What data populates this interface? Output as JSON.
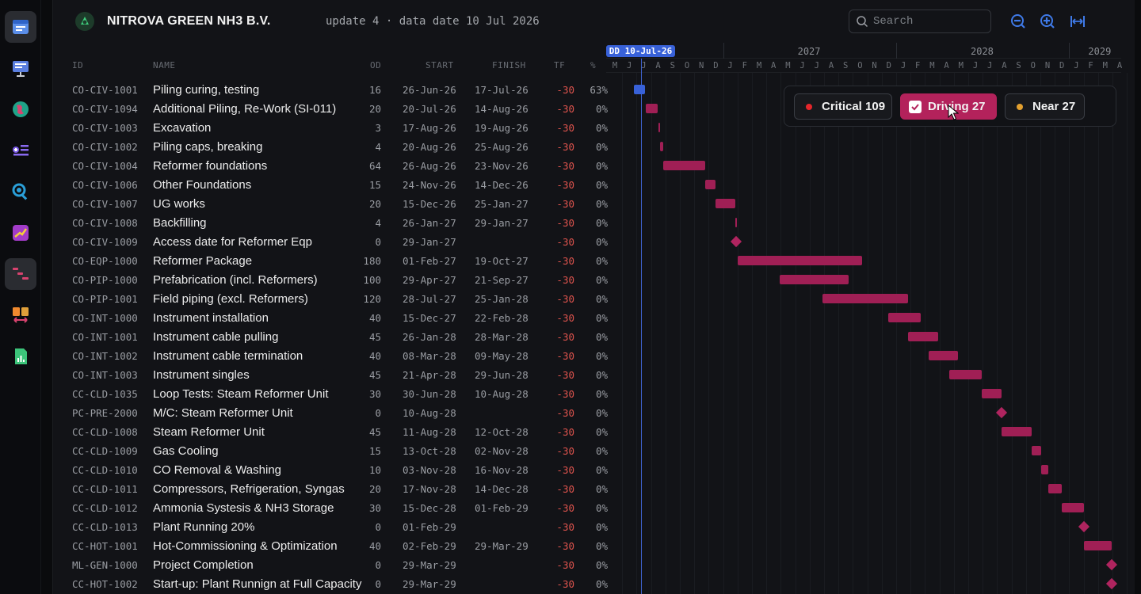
{
  "header": {
    "company": "NITROVA GREEN NH3 B.V.",
    "update": "update 4 · data date 10 Jul 2026",
    "search_placeholder": "Search"
  },
  "columns": {
    "id": "ID",
    "name": "NAME",
    "od": "OD",
    "start": "START",
    "finish": "FINISH",
    "tf": "TF",
    "pct": "%"
  },
  "timeline": {
    "data_date_label": "DD 10-Jul-26",
    "years": [
      "2027",
      "2028",
      "2029"
    ],
    "months": [
      "M",
      "J",
      "J",
      "A",
      "S",
      "O",
      "N",
      "D",
      "J",
      "F",
      "M",
      "A",
      "M",
      "J",
      "J",
      "A",
      "S",
      "O",
      "N",
      "D",
      "J",
      "F",
      "M",
      "A",
      "M",
      "J",
      "J",
      "A",
      "S",
      "O",
      "N",
      "D",
      "J",
      "F",
      "M",
      "A"
    ]
  },
  "filters": {
    "critical_label": "Critical 109",
    "driving_label": "Driving 27",
    "near_label": "Near 27",
    "critical_color": "#e5262b",
    "near_color": "#e3a02f",
    "driving_color": "#b3225b"
  },
  "activities": [
    {
      "id": "CO-CIV-1001",
      "name": "Piling curing, testing",
      "od": "16",
      "start": "26-Jun-26",
      "finish": "17-Jul-26",
      "tf": "-30",
      "pct": "63%"
    },
    {
      "id": "CO-CIV-1094",
      "name": "Additional Piling, Re-Work (SI-011)",
      "od": "20",
      "start": "20-Jul-26",
      "finish": "14-Aug-26",
      "tf": "-30",
      "pct": "0%"
    },
    {
      "id": "CO-CIV-1003",
      "name": "Excavation",
      "od": "3",
      "start": "17-Aug-26",
      "finish": "19-Aug-26",
      "tf": "-30",
      "pct": "0%"
    },
    {
      "id": "CO-CIV-1002",
      "name": "Piling caps, breaking",
      "od": "4",
      "start": "20-Aug-26",
      "finish": "25-Aug-26",
      "tf": "-30",
      "pct": "0%"
    },
    {
      "id": "CO-CIV-1004",
      "name": "Reformer foundations",
      "od": "64",
      "start": "26-Aug-26",
      "finish": "23-Nov-26",
      "tf": "-30",
      "pct": "0%"
    },
    {
      "id": "CO-CIV-1006",
      "name": "Other Foundations",
      "od": "15",
      "start": "24-Nov-26",
      "finish": "14-Dec-26",
      "tf": "-30",
      "pct": "0%"
    },
    {
      "id": "CO-CIV-1007",
      "name": "UG works",
      "od": "20",
      "start": "15-Dec-26",
      "finish": "25-Jan-27",
      "tf": "-30",
      "pct": "0%"
    },
    {
      "id": "CO-CIV-1008",
      "name": "Backfilling",
      "od": "4",
      "start": "26-Jan-27",
      "finish": "29-Jan-27",
      "tf": "-30",
      "pct": "0%"
    },
    {
      "id": "CO-CIV-1009",
      "name": "Access date for Reformer Eqp",
      "od": "0",
      "start": "29-Jan-27",
      "finish": "",
      "tf": "-30",
      "pct": "0%"
    },
    {
      "id": "CO-EQP-1000",
      "name": "Reformer Package",
      "od": "180",
      "start": "01-Feb-27",
      "finish": "19-Oct-27",
      "tf": "-30",
      "pct": "0%"
    },
    {
      "id": "CO-PIP-1000",
      "name": "Prefabrication (incl. Reformers)",
      "od": "100",
      "start": "29-Apr-27",
      "finish": "21-Sep-27",
      "tf": "-30",
      "pct": "0%"
    },
    {
      "id": "CO-PIP-1001",
      "name": "Field piping (excl. Reformers)",
      "od": "120",
      "start": "28-Jul-27",
      "finish": "25-Jan-28",
      "tf": "-30",
      "pct": "0%"
    },
    {
      "id": "CO-INT-1000",
      "name": "Instrument installation",
      "od": "40",
      "start": "15-Dec-27",
      "finish": "22-Feb-28",
      "tf": "-30",
      "pct": "0%"
    },
    {
      "id": "CO-INT-1001",
      "name": "Instrument cable pulling",
      "od": "45",
      "start": "26-Jan-28",
      "finish": "28-Mar-28",
      "tf": "-30",
      "pct": "0%"
    },
    {
      "id": "CO-INT-1002",
      "name": "Instrument cable termination",
      "od": "40",
      "start": "08-Mar-28",
      "finish": "09-May-28",
      "tf": "-30",
      "pct": "0%"
    },
    {
      "id": "CO-INT-1003",
      "name": "Instrument singles",
      "od": "45",
      "start": "21-Apr-28",
      "finish": "29-Jun-28",
      "tf": "-30",
      "pct": "0%"
    },
    {
      "id": "CC-CLD-1035",
      "name": "Loop Tests: Steam Reformer Unit",
      "od": "30",
      "start": "30-Jun-28",
      "finish": "10-Aug-28",
      "tf": "-30",
      "pct": "0%"
    },
    {
      "id": "PC-PRE-2000",
      "name": "M/C: Steam Reformer Unit",
      "od": "0",
      "start": "10-Aug-28",
      "finish": "",
      "tf": "-30",
      "pct": "0%"
    },
    {
      "id": "CC-CLD-1008",
      "name": "Steam Reformer Unit",
      "od": "45",
      "start": "11-Aug-28",
      "finish": "12-Oct-28",
      "tf": "-30",
      "pct": "0%"
    },
    {
      "id": "CC-CLD-1009",
      "name": "Gas Cooling",
      "od": "15",
      "start": "13-Oct-28",
      "finish": "02-Nov-28",
      "tf": "-30",
      "pct": "0%"
    },
    {
      "id": "CC-CLD-1010",
      "name": "CO Removal & Washing",
      "od": "10",
      "start": "03-Nov-28",
      "finish": "16-Nov-28",
      "tf": "-30",
      "pct": "0%"
    },
    {
      "id": "CC-CLD-1011",
      "name": "Compressors, Refrigeration, Syngas",
      "od": "20",
      "start": "17-Nov-28",
      "finish": "14-Dec-28",
      "tf": "-30",
      "pct": "0%"
    },
    {
      "id": "CC-CLD-1012",
      "name": "Ammonia Systesis & NH3 Storage",
      "od": "30",
      "start": "15-Dec-28",
      "finish": "01-Feb-29",
      "tf": "-30",
      "pct": "0%"
    },
    {
      "id": "CC-CLD-1013",
      "name": "Plant Running 20%",
      "od": "0",
      "start": "01-Feb-29",
      "finish": "",
      "tf": "-30",
      "pct": "0%"
    },
    {
      "id": "CC-HOT-1001",
      "name": "Hot-Commissioning & Optimization",
      "od": "40",
      "start": "02-Feb-29",
      "finish": "29-Mar-29",
      "tf": "-30",
      "pct": "0%"
    },
    {
      "id": "ML-GEN-1000",
      "name": "Project Completion",
      "od": "0",
      "start": "29-Mar-29",
      "finish": "",
      "tf": "-30",
      "pct": "0%"
    },
    {
      "id": "CC-HOT-1002",
      "name": "Start-up: Plant Runnign at Full Capacity",
      "od": "0",
      "start": "29-Mar-29",
      "finish": "",
      "tf": "-30",
      "pct": "0%"
    }
  ]
}
